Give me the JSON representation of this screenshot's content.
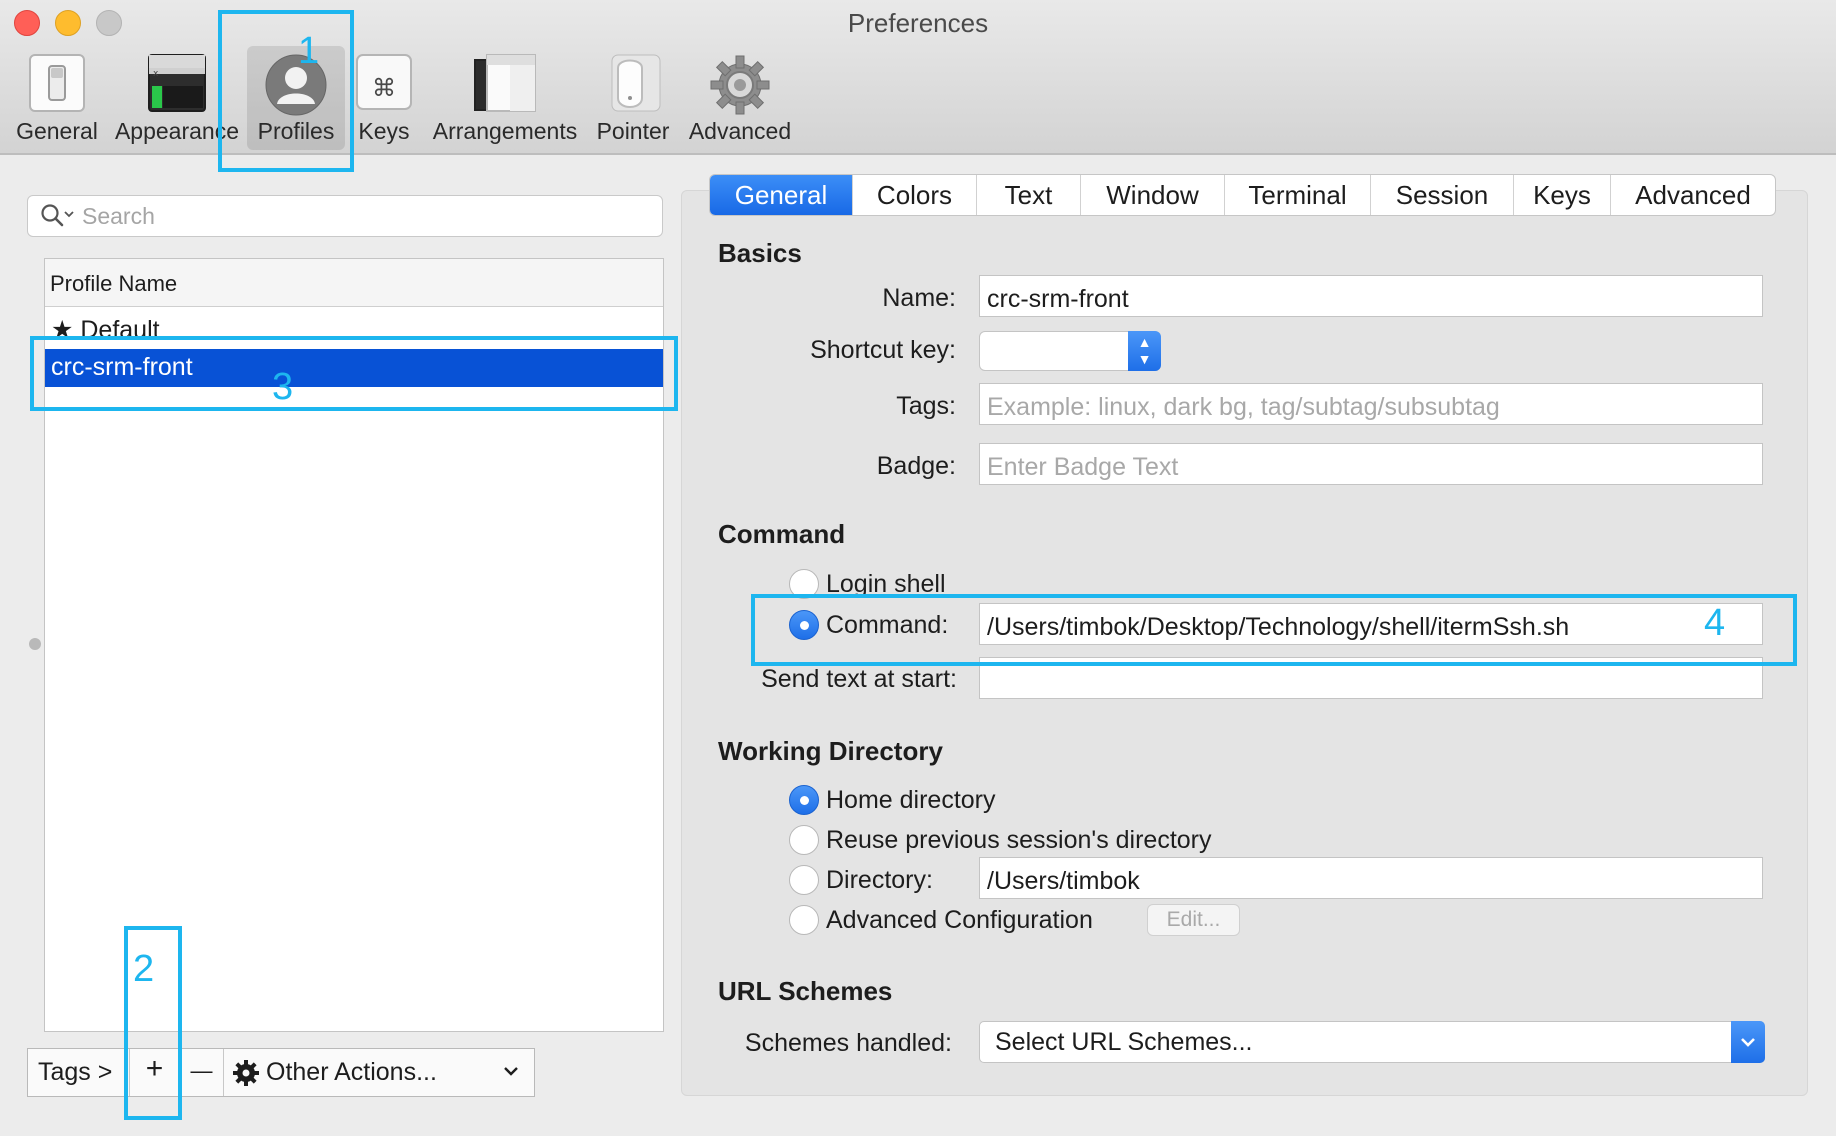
{
  "window": {
    "title": "Preferences"
  },
  "toolbar": {
    "items": [
      {
        "label": "General",
        "icon": "general-switch-icon"
      },
      {
        "label": "Appearance",
        "icon": "appearance-window-icon"
      },
      {
        "label": "Profiles",
        "icon": "profile-person-icon"
      },
      {
        "label": "Keys",
        "icon": "command-key-icon"
      },
      {
        "label": "Arrangements",
        "icon": "arrangements-windows-icon"
      },
      {
        "label": "Pointer",
        "icon": "mouse-icon"
      },
      {
        "label": "Advanced",
        "icon": "gear-icon"
      }
    ],
    "selected": "Profiles"
  },
  "profiles": {
    "search_placeholder": "Search",
    "column_header": "Profile Name",
    "items": [
      {
        "name": "Default",
        "is_default": true
      },
      {
        "name": "crc-srm-front",
        "selected": true
      }
    ],
    "bottom_bar": {
      "tags_label": "Tags >",
      "add_label": "+",
      "remove_label": "—",
      "actions_label": "Other Actions..."
    }
  },
  "tabs": {
    "items": [
      "General",
      "Colors",
      "Text",
      "Window",
      "Terminal",
      "Session",
      "Keys",
      "Advanced"
    ],
    "active": "General"
  },
  "basics": {
    "heading": "Basics",
    "name_label": "Name:",
    "name_value": "crc-srm-front",
    "shortcut_label": "Shortcut key:",
    "tags_label": "Tags:",
    "tags_placeholder": "Example: linux, dark bg, tag/subtag/subsubtag",
    "badge_label": "Badge:",
    "badge_placeholder": "Enter Badge Text"
  },
  "command": {
    "heading": "Command",
    "login_shell_label": "Login shell",
    "command_label": "Command:",
    "command_value": "/Users/timbok/Desktop/Technology/shell/itermSsh.sh",
    "send_text_label": "Send text at start:",
    "send_text_value": ""
  },
  "working_directory": {
    "heading": "Working Directory",
    "home_label": "Home directory",
    "reuse_label": "Reuse previous session's directory",
    "directory_label": "Directory:",
    "directory_value": "/Users/timbok",
    "advanced_label": "Advanced Configuration",
    "edit_label": "Edit..."
  },
  "url_schemes": {
    "heading": "URL Schemes",
    "handled_label": "Schemes handled:",
    "select_value": "Select URL Schemes..."
  },
  "annotations": [
    "1",
    "2",
    "3",
    "4"
  ],
  "colors": {
    "accent": "#1869e6",
    "selection": "#0852d6",
    "annotation": "#1db6ef"
  }
}
